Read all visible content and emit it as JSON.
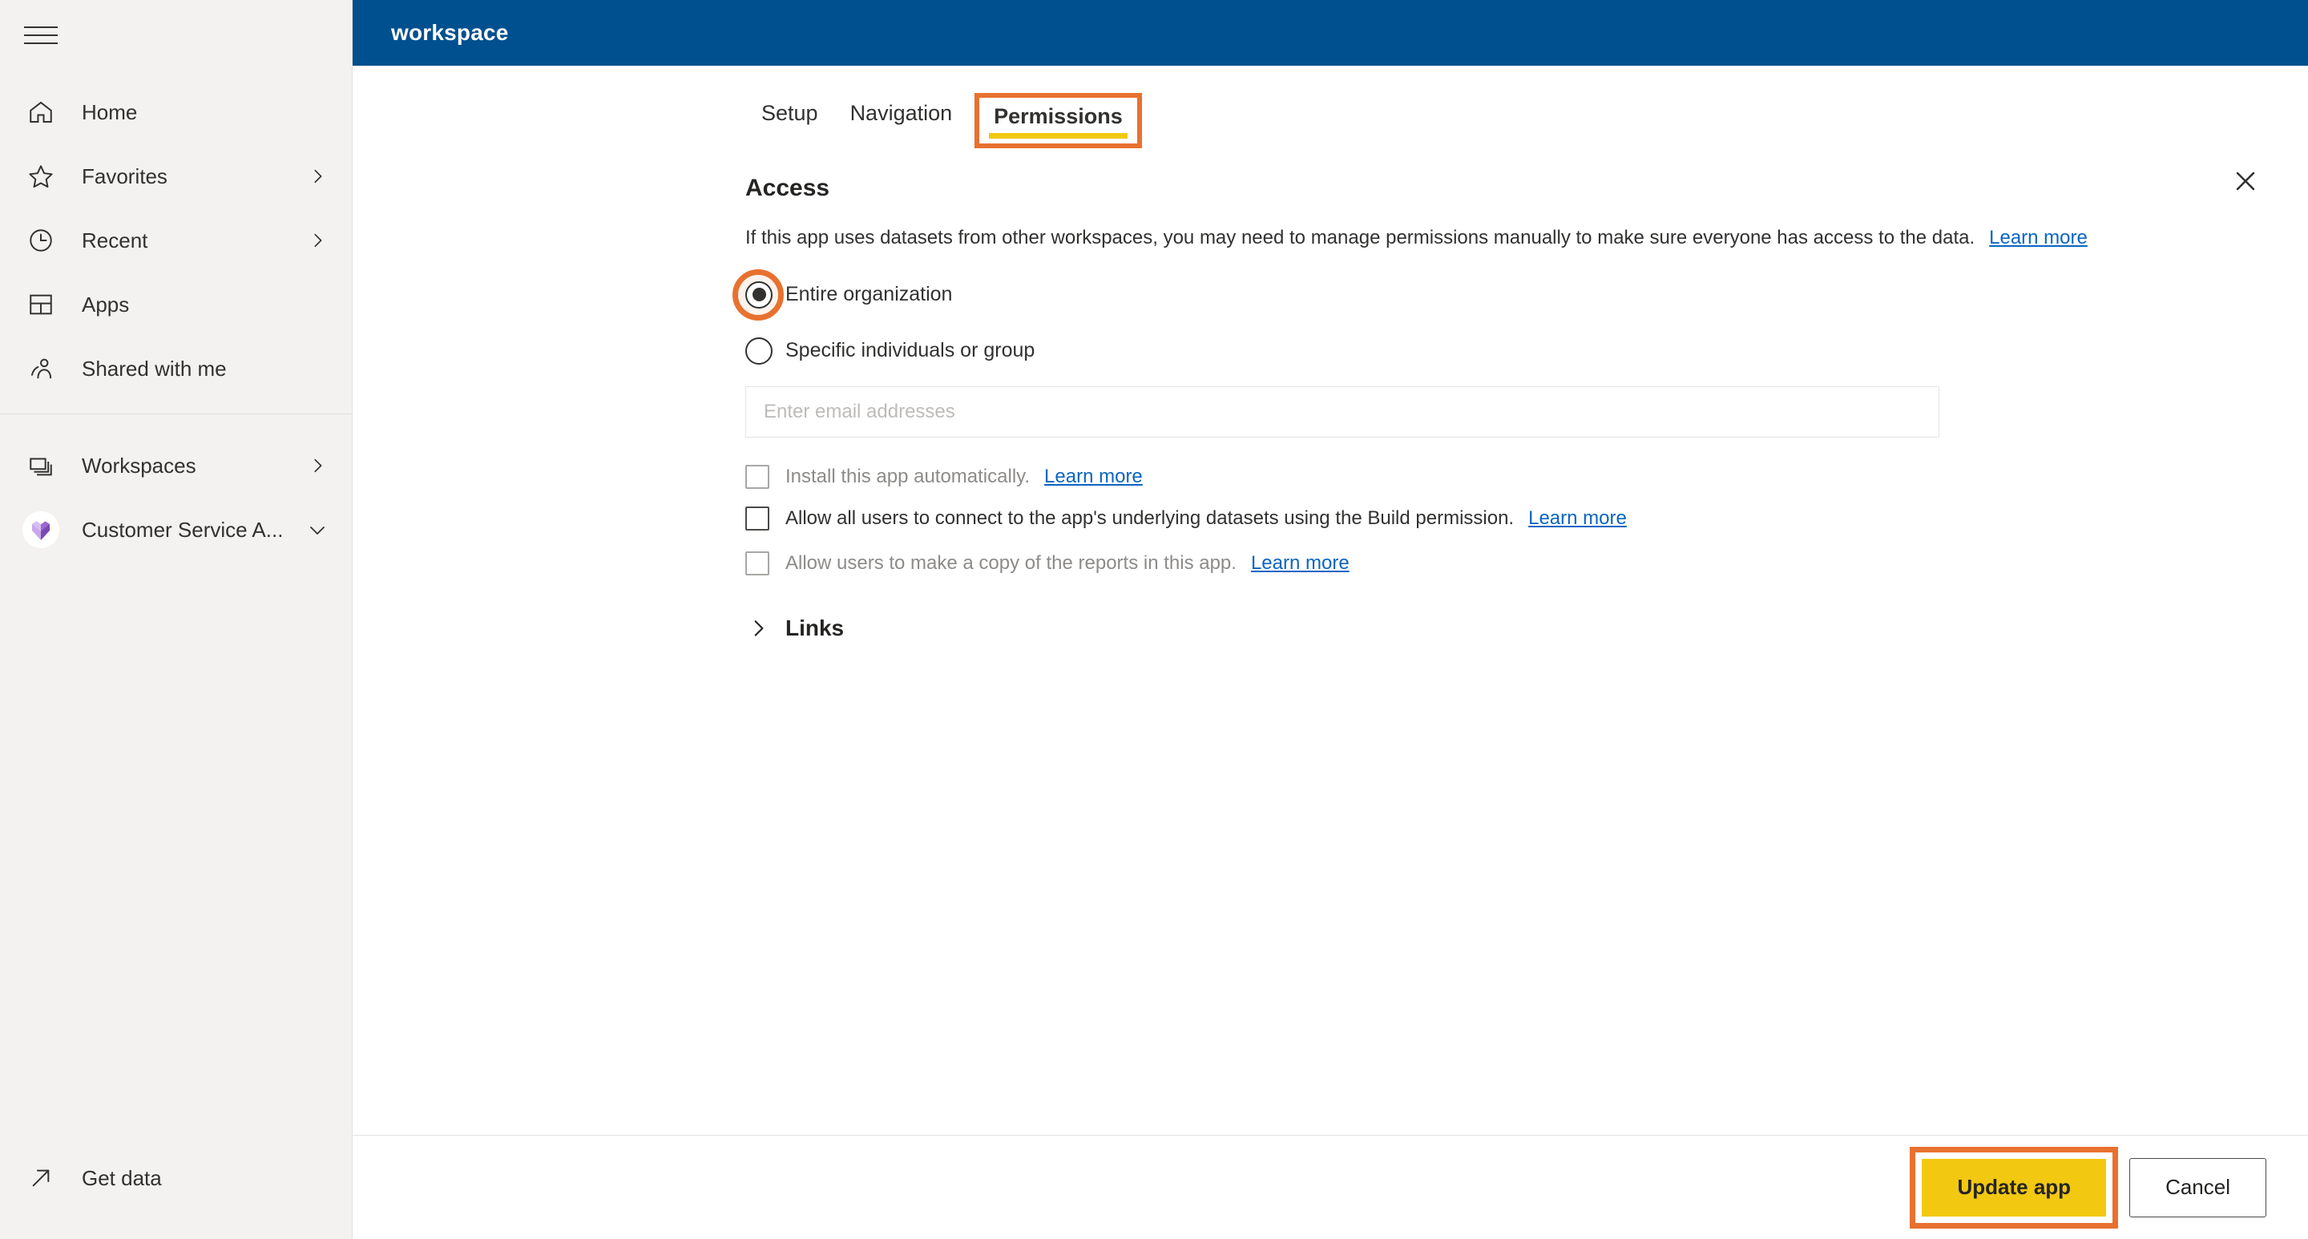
{
  "sidebar": {
    "menu_toggle": "hamburger-menu",
    "items": [
      {
        "label": "Home",
        "icon": "home-icon",
        "chevron": false
      },
      {
        "label": "Favorites",
        "icon": "star-icon",
        "chevron": true
      },
      {
        "label": "Recent",
        "icon": "clock-icon",
        "chevron": true
      },
      {
        "label": "Apps",
        "icon": "apps-grid-icon",
        "chevron": false
      },
      {
        "label": "Shared with me",
        "icon": "people-icon",
        "chevron": false
      }
    ],
    "group_items": [
      {
        "label": "Workspaces",
        "icon": "workspaces-stack-icon",
        "chevron": true
      },
      {
        "label": "Customer Service A...",
        "icon": "app-avatar-icon",
        "chevron": true
      }
    ],
    "bottom": {
      "label": "Get data",
      "icon": "arrow-up-right-icon"
    }
  },
  "header": {
    "title": "workspace",
    "background": "#00508F",
    "close_icon": "close-icon"
  },
  "tabs": [
    {
      "label": "Setup",
      "active": false
    },
    {
      "label": "Navigation",
      "active": false
    },
    {
      "label": "Permissions",
      "active": true,
      "highlighted": true
    }
  ],
  "access": {
    "title": "Access",
    "description": "If this app uses datasets from other workspaces, you may need to manage permissions manually to make sure everyone has access to the data.",
    "description_link": "Learn more",
    "radios": [
      {
        "label": "Entire organization",
        "selected": true,
        "highlighted": true
      },
      {
        "label": "Specific individuals or group",
        "selected": false,
        "highlighted": false
      }
    ],
    "email_field": {
      "value": "",
      "placeholder": "Enter email addresses"
    },
    "checkboxes": [
      {
        "label": "Install this app automatically.",
        "link": "Learn more",
        "checked": false,
        "disabled": true
      },
      {
        "label": "Allow all users to connect to the app's underlying datasets using the Build permission.",
        "link": "Learn more",
        "checked": false,
        "disabled": false
      },
      {
        "label": "Allow users to make a copy of the reports in this app.",
        "link": "Learn more",
        "checked": false,
        "disabled": true
      }
    ]
  },
  "links_section": {
    "label": "Links",
    "expanded": false,
    "chevron_icon": "chevron-right-icon"
  },
  "footer": {
    "primary_label": "Update app",
    "secondary_label": "Cancel",
    "primary_color": "#F2C811",
    "highlight_color": "#E8712F"
  }
}
